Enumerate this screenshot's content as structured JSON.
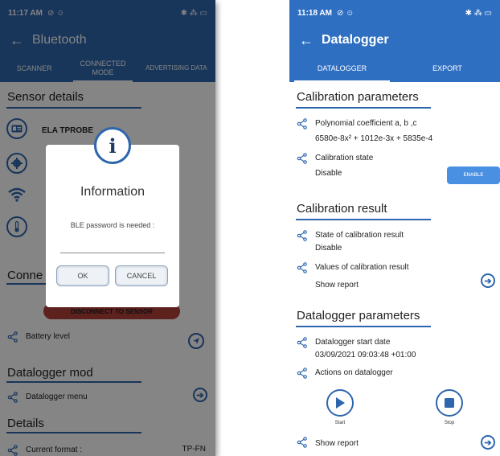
{
  "colors": {
    "primary": "#2e66ad",
    "accent": "#2f6fc2",
    "danger": "#b5413b"
  },
  "left": {
    "status": {
      "time": "11:17 AM",
      "icons_left": "⊘ ☺",
      "icons_right": "✱ ⁂ ▭"
    },
    "appbar": {
      "back": "←",
      "title": "Bluetooth"
    },
    "tabs": [
      {
        "label": "SCANNER",
        "active": false
      },
      {
        "label": "CONNECTED MODE",
        "active": true
      },
      {
        "label": "ADVERTISING DATA",
        "active": false
      }
    ],
    "sensor_details": {
      "title": "Sensor details",
      "device_name": "ELA TPROBE"
    },
    "connection": {
      "title": "Conne"
    },
    "disconnect_label": "DISCONNECT TO SENSOR",
    "battery": {
      "label": "Battery level"
    },
    "datalogger_mod": {
      "title": "Datalogger mod",
      "menu_label": "Datalogger menu"
    },
    "details": {
      "title": "Details",
      "row_label": "Current format :",
      "row_value": "TP-FN"
    },
    "dialog": {
      "icon": "i",
      "title": "Information",
      "message": "BLE password is needed :",
      "input_value": "",
      "ok_label": "OK",
      "cancel_label": "CANCEL"
    }
  },
  "right": {
    "status": {
      "time": "11:18 AM",
      "icons_left": "⊘ ☺",
      "icons_right": "✱ ⁂ ▭"
    },
    "appbar": {
      "back": "←",
      "title": "Datalogger"
    },
    "tabs": [
      {
        "label": "DATALOGGER",
        "active": true
      },
      {
        "label": "EXPORT",
        "active": false
      }
    ],
    "calibration_parameters": {
      "title": "Calibration parameters",
      "coef_label": "Polynomial coefficient a, b ,c",
      "coef_value": "6580e-8x² + 1012e-3x + 5835e-4",
      "state_label": "Calibration state",
      "state_value": "Disable",
      "state_button": "ENABLE"
    },
    "calibration_result": {
      "title": "Calibration result",
      "state_label": "State of calibration result",
      "state_value": "Disable",
      "values_label": "Values of calibration result",
      "values_value": "Show report"
    },
    "datalogger_parameters": {
      "title": "Datalogger parameters",
      "start_label": "Datalogger start date",
      "start_value": "03/09/2021 09:03:48 +01:00",
      "actions_label": "Actions on datalogger",
      "start_button": "Start",
      "stop_button": "Stop",
      "report_label": "Show report"
    },
    "arrow": "➔"
  }
}
